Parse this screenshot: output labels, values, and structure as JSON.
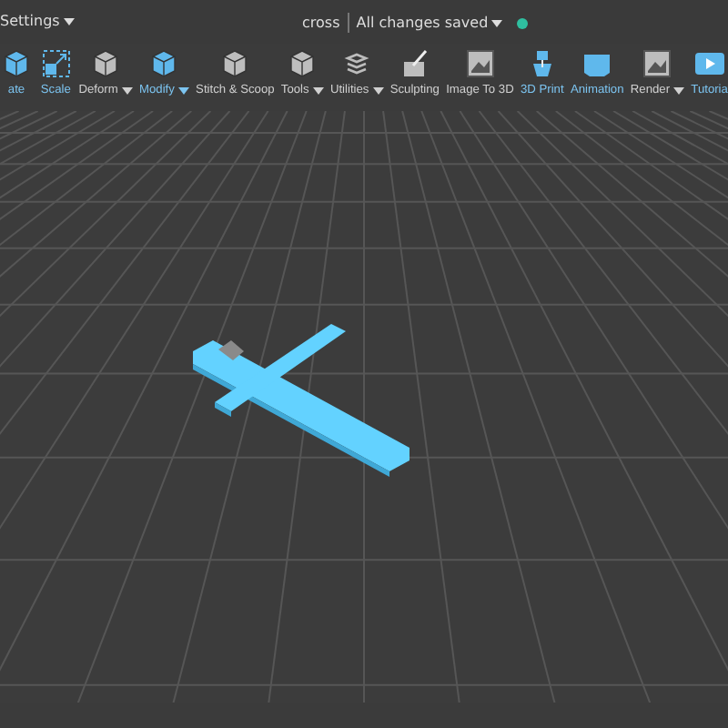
{
  "top_bar": {
    "settings_menu": {
      "label": "Settings",
      "has_menu": true
    },
    "file_name": "cross",
    "save_status": {
      "label": "All changes saved",
      "has_menu": true,
      "color": "#2fbfa0"
    }
  },
  "toolbar": [
    {
      "label": "ate",
      "highlighted": true,
      "has_menu": false
    },
    {
      "label": "Scale",
      "highlighted": true,
      "has_menu": false
    },
    {
      "label": "Deform",
      "highlighted": false,
      "has_menu": true
    },
    {
      "label": "Modify",
      "highlighted": true,
      "has_menu": true
    },
    {
      "label": "Stitch & Scoop",
      "highlighted": false,
      "has_menu": false
    },
    {
      "label": "Tools",
      "highlighted": false,
      "has_menu": true
    },
    {
      "label": "Utilities",
      "highlighted": false,
      "has_menu": true
    },
    {
      "label": "Sculpting",
      "highlighted": false,
      "has_menu": false
    },
    {
      "label": "Image To 3D",
      "highlighted": false,
      "has_menu": false
    },
    {
      "label": "3D Print",
      "highlighted": true,
      "has_menu": false
    },
    {
      "label": "Animation",
      "highlighted": true,
      "has_menu": false
    },
    {
      "label": "Render",
      "highlighted": false,
      "has_menu": true
    },
    {
      "label": "Tutoria",
      "highlighted": true,
      "has_menu": false
    }
  ]
}
